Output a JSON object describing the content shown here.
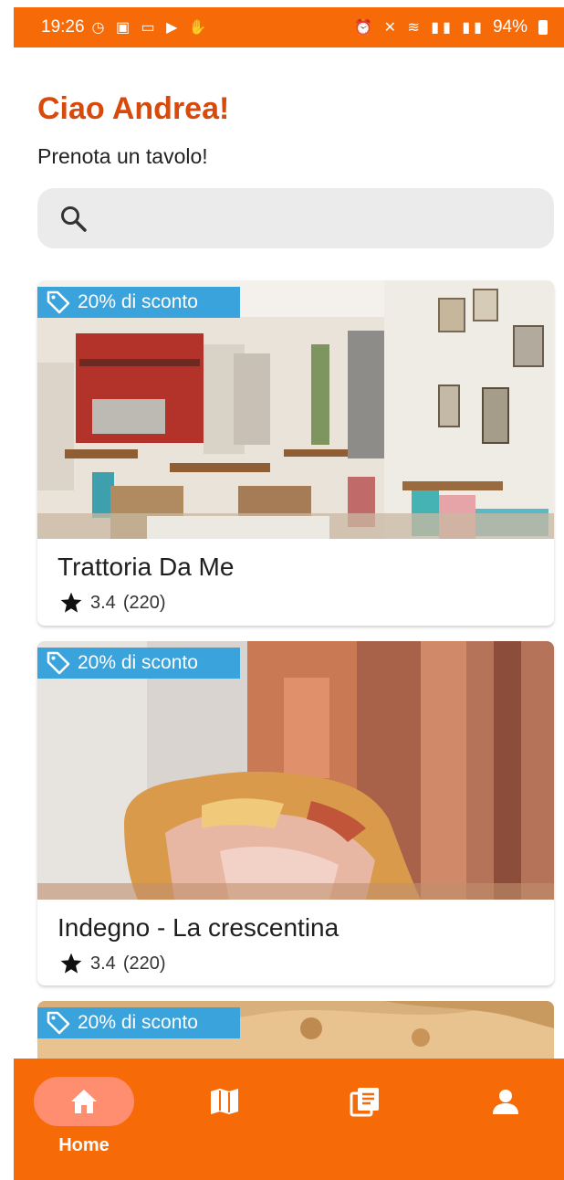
{
  "status_bar": {
    "time": "19:26",
    "battery": "94%"
  },
  "header": {
    "greeting": "Ciao Andrea!",
    "subtitle": "Prenota un tavolo!"
  },
  "search": {
    "value": ""
  },
  "restaurants": [
    {
      "name": "Trattoria Da Me",
      "discount": "20% di sconto",
      "rating": "3.4",
      "reviews": "(220)"
    },
    {
      "name": "Indegno - La crescentina",
      "discount": "20% di sconto",
      "rating": "3.4",
      "reviews": "(220)"
    },
    {
      "discount": "20% di sconto"
    }
  ],
  "bottom_nav": {
    "items": [
      {
        "label": "Home",
        "icon": "home-icon",
        "active": true
      },
      {
        "icon": "map-icon"
      },
      {
        "icon": "menu-book-icon"
      },
      {
        "icon": "profile-icon"
      }
    ]
  },
  "colors": {
    "brand": "#f66a08",
    "accent_text": "#d84a0c",
    "discount_badge": "#3ba3db",
    "active_pill": "#ff8d70"
  }
}
